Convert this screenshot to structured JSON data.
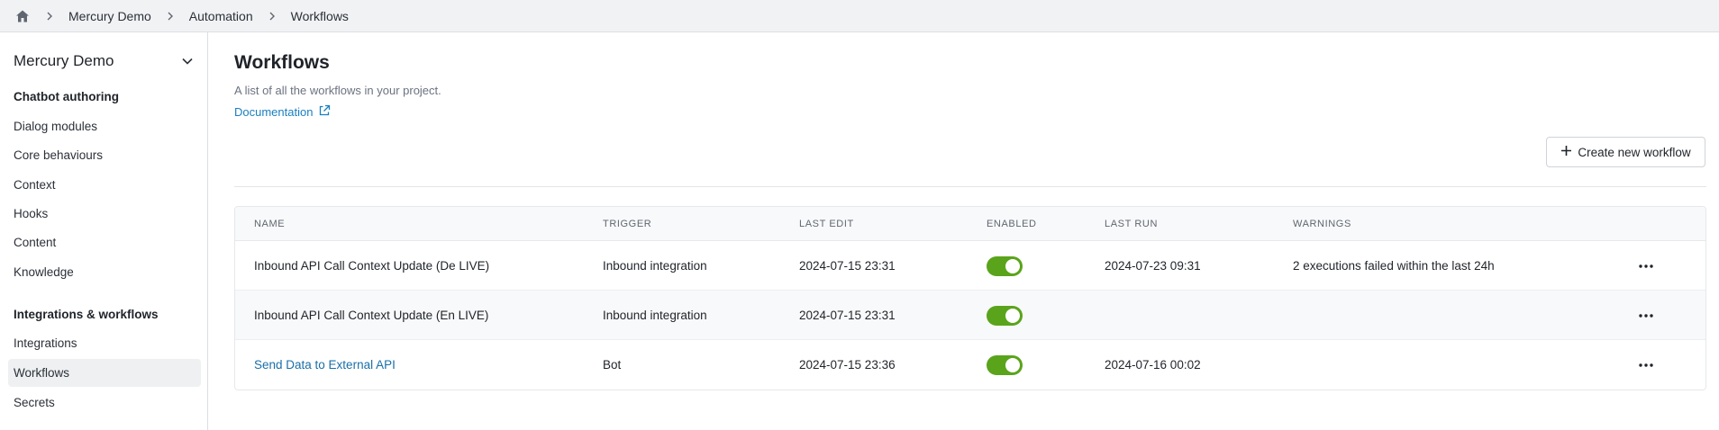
{
  "breadcrumb": {
    "home_icon": "home-icon",
    "items": [
      "Mercury Demo",
      "Automation",
      "Workflows"
    ]
  },
  "sidebar": {
    "project_name": "Mercury Demo",
    "sections": [
      {
        "title": "Chatbot authoring",
        "items": [
          "Dialog modules",
          "Core behaviours",
          "Context",
          "Hooks",
          "Content",
          "Knowledge"
        ]
      },
      {
        "title": "Integrations & workflows",
        "items": [
          "Integrations",
          "Workflows",
          "Secrets"
        ]
      }
    ],
    "active_item": "Workflows"
  },
  "main": {
    "title": "Workflows",
    "subtitle": "A list of all the workflows in your project.",
    "doc_link": "Documentation",
    "create_button": "Create new workflow"
  },
  "table": {
    "columns": [
      "NAME",
      "TRIGGER",
      "LAST EDIT",
      "ENABLED",
      "LAST RUN",
      "WARNINGS"
    ],
    "rows": [
      {
        "name": "Inbound API Call Context Update (De LIVE)",
        "trigger": "Inbound integration",
        "last_edit": "2024-07-15 23:31",
        "enabled": true,
        "last_run": "2024-07-23 09:31",
        "warnings": "2 executions failed within the last 24h"
      },
      {
        "name": "Inbound API Call Context Update (En LIVE)",
        "trigger": "Inbound integration",
        "last_edit": "2024-07-15 23:31",
        "enabled": true,
        "last_run": "",
        "warnings": ""
      },
      {
        "name": "Send Data to External API",
        "trigger": "Bot",
        "last_edit": "2024-07-15 23:36",
        "enabled": true,
        "last_run": "2024-07-16 00:02",
        "warnings": ""
      }
    ]
  },
  "colors": {
    "toggle_on": "#5aa41b",
    "link": "#1a7fbf"
  }
}
